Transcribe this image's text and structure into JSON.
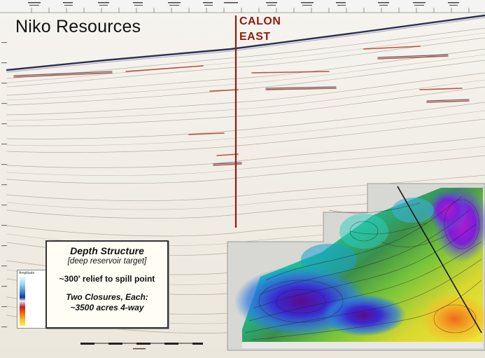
{
  "company_name": "Niko Resources",
  "well_label": {
    "line1": "CALON",
    "line2": "EAST"
  },
  "legend": {
    "title": "Depth Structure",
    "subtitle": "[deep reservoir target]",
    "relief": "~300' relief to spill point",
    "closures_line1": "Two Closures, Each:",
    "closures_line2": "~3500 acres 4-way"
  },
  "amplitude_key": {
    "title": "Amplitude"
  },
  "colors": {
    "well_line": "#8c1c12",
    "seabed": "#2b3050",
    "map_deep": "#7a0ea8",
    "map_shallow": "#f2e530"
  }
}
